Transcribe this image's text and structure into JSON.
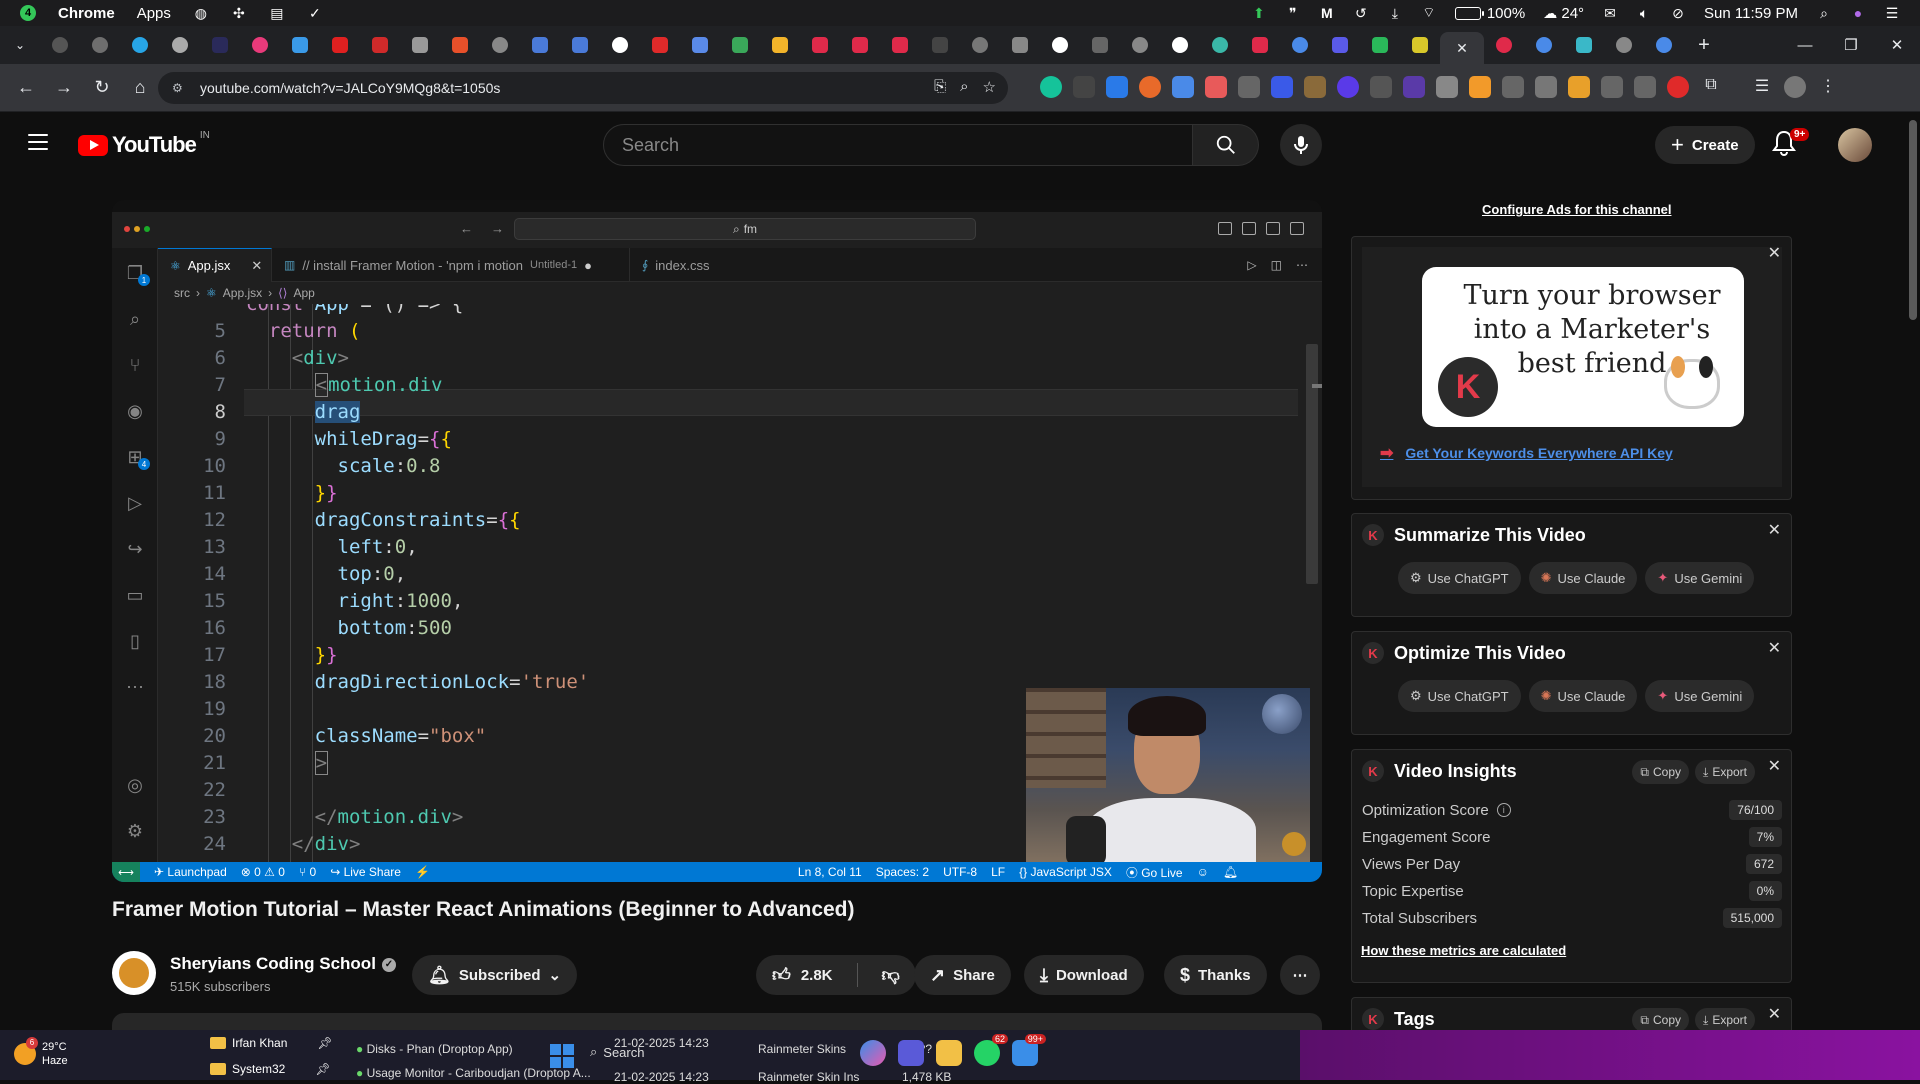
{
  "menubar": {
    "app_name": "Chrome",
    "apps_label": "Apps",
    "battery": "100%",
    "weather": "24°",
    "datetime": "Sun 11:59 PM"
  },
  "browser": {
    "url": "youtube.com/watch?v=JALCoY9MQg8&t=1050s"
  },
  "youtube": {
    "wordmark": "YouTube",
    "region": "IN",
    "search_placeholder": "Search",
    "create_label": "Create",
    "notifications_badge": "9+"
  },
  "vscode": {
    "command_center": "fm",
    "tabs": [
      {
        "label": "App.jsx"
      },
      {
        "label": "// install Framer Motion - 'npm i motion",
        "note": "Untitled-1"
      },
      {
        "label": "index.css"
      }
    ],
    "breadcrumb": [
      "src",
      "App.jsx",
      "App"
    ],
    "explorer_badge": "1",
    "extensions_badge": "4",
    "line_numbers": [
      "5",
      "6",
      "7",
      "8",
      "9",
      "10",
      "11",
      "12",
      "13",
      "14",
      "15",
      "16",
      "17",
      "18",
      "19",
      "20",
      "21",
      "22",
      "23",
      "24"
    ],
    "status": {
      "launchpad": "Launchpad",
      "problems": "⊗ 0 ⚠ 0",
      "ports": "0",
      "live_share": "Live Share",
      "position": "Ln 8, Col 11",
      "spaces": "Spaces: 2",
      "encoding": "UTF-8",
      "eol": "LF",
      "language": "JavaScript JSX",
      "go_live": "Go Live"
    }
  },
  "video": {
    "title": "Framer Motion Tutorial – Master React Animations (Beginner to Advanced)",
    "channel": "Sheryians Coding School",
    "subscribers": "515K subscribers",
    "subscribed_label": "Subscribed",
    "likes": "2.8K",
    "share_label": "Share",
    "download_label": "Download",
    "thanks_label": "Thanks"
  },
  "sidebar": {
    "configure_ads": "Configure Ads for this channel",
    "ad_text": "Turn your browser into a Marketer's best friend",
    "ad_link": "Get Your Keywords Everywhere API Key",
    "summarize_title": "Summarize This Video",
    "optimize_title": "Optimize This Video",
    "ai_buttons": [
      "Use ChatGPT",
      "Use Claude",
      "Use Gemini"
    ],
    "insights_title": "Video Insights",
    "copy_label": "Copy",
    "export_label": "Export",
    "metrics": [
      {
        "label": "Optimization Score",
        "value": "76/100"
      },
      {
        "label": "Engagement Score",
        "value": "7%"
      },
      {
        "label": "Views Per Day",
        "value": "672"
      },
      {
        "label": "Topic Expertise",
        "value": "0%"
      },
      {
        "label": "Total Subscribers",
        "value": "515,000"
      }
    ],
    "metrics_link": "How these metrics are calculated",
    "tags_title": "Tags"
  },
  "taskbar": {
    "temperature": "29°C",
    "condition": "Haze",
    "weather_badge": "6",
    "folder1": "Irfan Khan",
    "folder2": "System32",
    "task1": "Disks - Phan (Droptop App)",
    "task2": "Usage Monitor - Cariboudjan (Droptop A...",
    "search_label": "Search",
    "date1": "21-02-2025 14:23",
    "date2": "21-02-2025 14:23",
    "rainmeter1": "Rainmeter Skins",
    "rainmeter2": "Rainmeter Skin Ins",
    "kb1": "1,3?? KB",
    "kb2": "1,478 KB",
    "whatsapp_badge": "62",
    "teams_badge": "99+"
  },
  "colors": {
    "youtube_red": "#ff0000",
    "vscode_status": "#0078d4",
    "keywords_red": "#e33a4a"
  }
}
